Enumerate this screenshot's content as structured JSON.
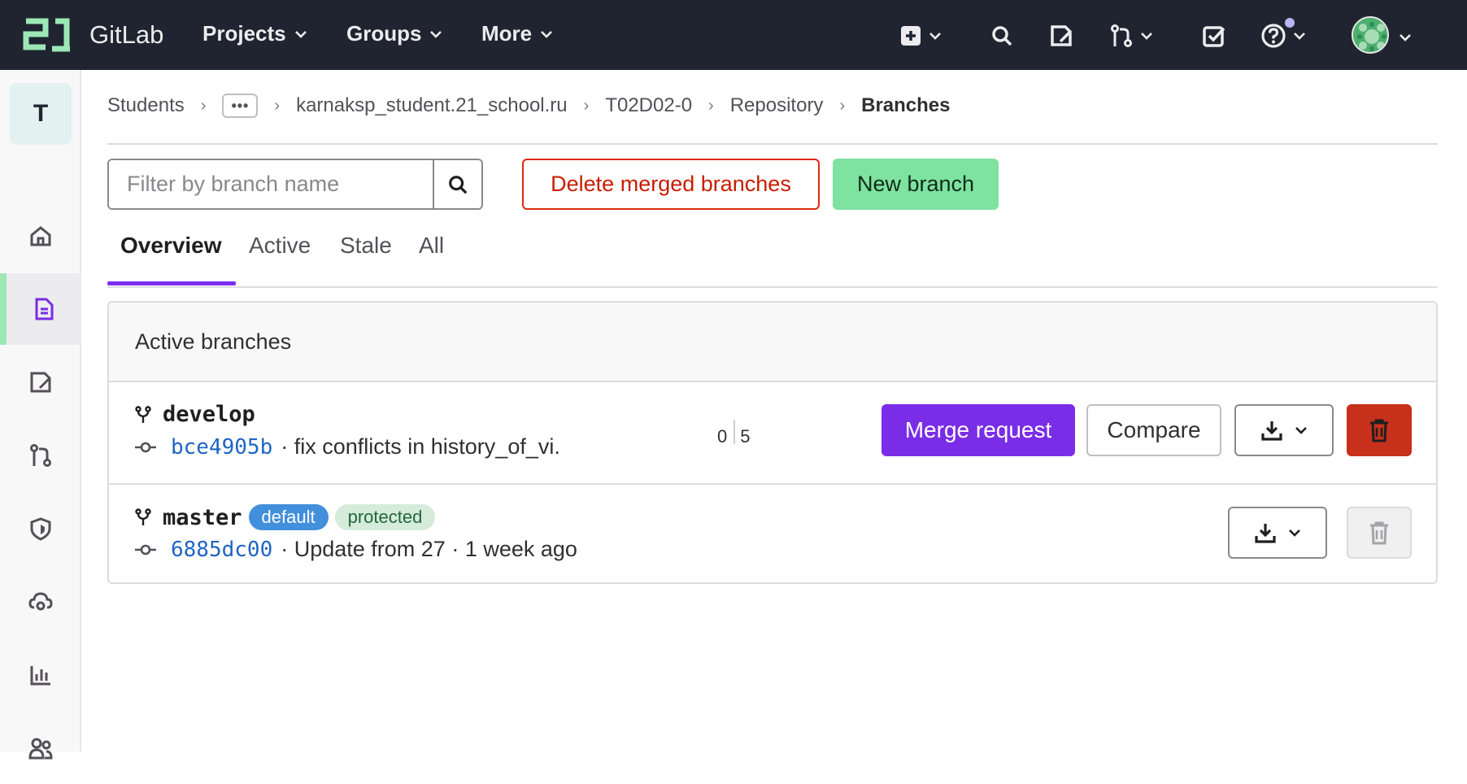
{
  "navbar": {
    "brand": "GitLab",
    "menus": [
      {
        "label": "Projects"
      },
      {
        "label": "Groups"
      },
      {
        "label": "More"
      }
    ]
  },
  "sidebar": {
    "project_initial": "T"
  },
  "breadcrumbs": {
    "items": [
      "Students",
      "karnaksp_student.21_school.ru",
      "T02D02-0",
      "Repository"
    ],
    "current": "Branches",
    "more": "•••"
  },
  "toolbar": {
    "filter_placeholder": "Filter by branch name",
    "delete_merged_label": "Delete merged branches",
    "new_branch_label": "New branch"
  },
  "tabs": [
    {
      "label": "Overview",
      "active": true
    },
    {
      "label": "Active",
      "active": false
    },
    {
      "label": "Stale",
      "active": false
    },
    {
      "label": "All",
      "active": false
    }
  ],
  "active_branches": {
    "title": "Active branches",
    "branches": [
      {
        "name": "develop",
        "sha": "bce4905b",
        "message": "· fix conflicts in history_of_vi.",
        "behind": "0",
        "ahead": "5",
        "merge_request_label": "Merge request",
        "compare_label": "Compare"
      },
      {
        "name": "master",
        "badge_default": "default",
        "badge_protected": "protected",
        "sha": "6885dc00",
        "message": "· Update from 27 · 1 week ago"
      }
    ]
  },
  "colors": {
    "navbar_bg": "#1f2430",
    "accent_purple": "#7a2de6",
    "new_branch_green": "#7ee2a0",
    "danger_red": "#c7301a",
    "link_blue": "#1f64c4"
  }
}
